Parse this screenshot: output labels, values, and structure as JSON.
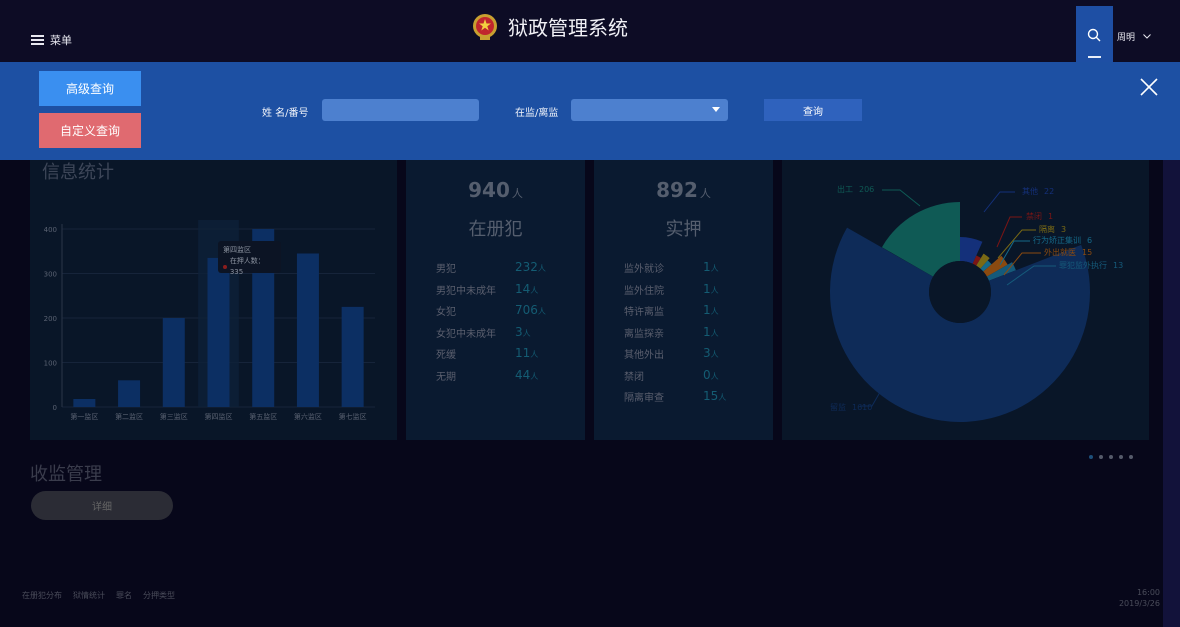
{
  "header": {
    "menu_label": "菜单",
    "app_title": "狱政管理系统",
    "user_name": "周明"
  },
  "search_panel": {
    "advanced_btn": "高级查询",
    "custom_btn": "自定义查询",
    "name_label": "姓 名/番号",
    "status_label": "在监/离监",
    "status_value": "",
    "name_value": "",
    "query_btn": "查询"
  },
  "info_stats": {
    "title": "信息统计",
    "tooltip_title": "第四监区",
    "tooltip_text": "在押人数：335"
  },
  "chart_data": {
    "type": "bar",
    "categories": [
      "第一监区",
      "第二监区",
      "第三监区",
      "第四监区",
      "第五监区",
      "第六监区",
      "第七监区"
    ],
    "values": [
      18,
      60,
      200,
      335,
      400,
      345,
      225
    ],
    "ylim": [
      0,
      400
    ],
    "yticks": [
      "0",
      "100",
      "200",
      "300",
      "400"
    ],
    "grid": true,
    "color": "#0c2f63"
  },
  "registered": {
    "count": "940",
    "unit": "人",
    "label": "在册犯",
    "rows": [
      {
        "label": "男犯",
        "value": "232",
        "unit": "人"
      },
      {
        "label": "男犯中未成年",
        "value": "14",
        "unit": "人"
      },
      {
        "label": "女犯",
        "value": "706",
        "unit": "人"
      },
      {
        "label": "女犯中未成年",
        "value": "3",
        "unit": "人"
      },
      {
        "label": "死缓",
        "value": "11",
        "unit": "人"
      },
      {
        "label": "无期",
        "value": "44",
        "unit": "人"
      }
    ]
  },
  "detained": {
    "count": "892",
    "unit": "人",
    "label": "实押",
    "rows": [
      {
        "label": "监外就诊",
        "value": "1",
        "unit": "人"
      },
      {
        "label": "监外住院",
        "value": "1",
        "unit": "人"
      },
      {
        "label": "特许离监",
        "value": "1",
        "unit": "人"
      },
      {
        "label": "离监探亲",
        "value": "1",
        "unit": "人"
      },
      {
        "label": "其他外出",
        "value": "3",
        "unit": "人"
      },
      {
        "label": "禁闭",
        "value": "0",
        "unit": "人"
      },
      {
        "label": "隔离审查",
        "value": "15",
        "unit": "人"
      }
    ]
  },
  "pie_chart": {
    "type": "pie",
    "slices": [
      {
        "name": "出工",
        "value": 206,
        "color": "#0f5a55"
      },
      {
        "name": "其他",
        "value": 22,
        "color": "#14307a"
      },
      {
        "name": "禁闭",
        "value": 1,
        "color": "#7a1515"
      },
      {
        "name": "隔离",
        "value": 3,
        "color": "#7a6a15"
      },
      {
        "name": "行为矫正集训",
        "value": 6,
        "color": "#156a8a"
      },
      {
        "name": "外出就医",
        "value": 15,
        "color": "#8a4a10"
      },
      {
        "name": "罪犯监外执行",
        "value": 13,
        "color": "#155a7a"
      },
      {
        "name": "留监",
        "value": 1610,
        "color": "#0e2b58"
      }
    ]
  },
  "labels": {
    "intake_title": "收监管理",
    "detail_btn": "详细"
  },
  "footer": {
    "links": [
      "在册犯分布",
      "狱情统计",
      "罪名",
      "分押类型"
    ],
    "time": "16:00",
    "date": "2019/3/26"
  },
  "colors": {
    "header_bg": "#0d0c25",
    "panel_bg": "#1d50a3",
    "accent_blue": "#3a8ff0",
    "accent_red": "#e06a70"
  }
}
